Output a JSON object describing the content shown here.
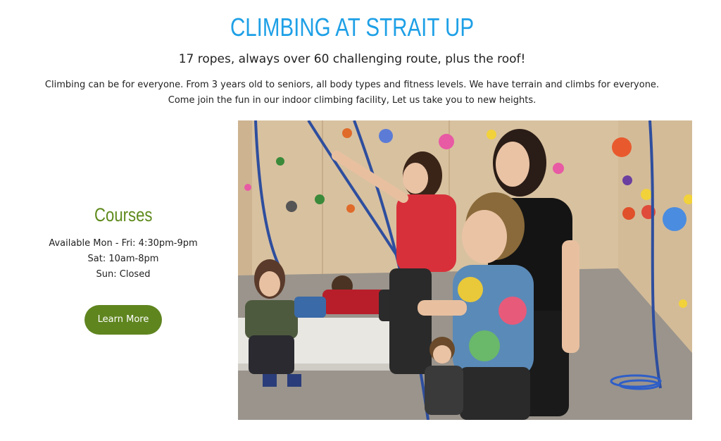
{
  "header": {
    "title": "CLIMBING AT STRAIT UP",
    "subtitle": "17 ropes, always over 60 challenging route, plus the roof!",
    "intro_line1": "Climbing can be for everyone.  From 3 years old to seniors, all body types and fitness levels.  We have terrain and climbs for everyone.",
    "intro_line2": "Come join the fun in our indoor climbing facility,  Let us take you to new heights."
  },
  "courses": {
    "title": "Courses",
    "hours": [
      "Available Mon - Fri: 4:30pm-9pm",
      "Sat: 10am-8pm",
      "Sun: Closed"
    ],
    "button_label": "Learn More"
  },
  "colors": {
    "title": "#1ea0e6",
    "courses_title": "#5f8a1d",
    "button": "#5f851f"
  },
  "photo": {
    "subject": "climbing-gym-photo"
  }
}
